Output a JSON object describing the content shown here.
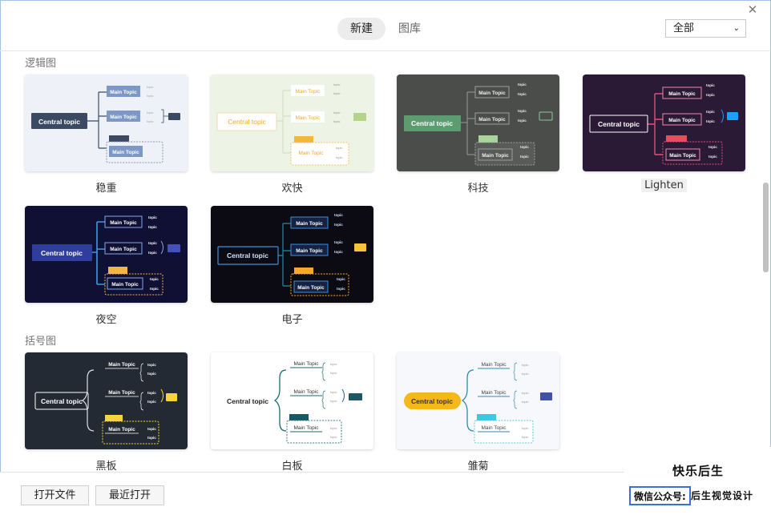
{
  "header": {
    "tabs": [
      {
        "label": "新建",
        "active": true
      },
      {
        "label": "图库",
        "active": false
      }
    ],
    "filter": {
      "value": "全部"
    },
    "close_icon": "close-icon"
  },
  "sections": [
    {
      "title": "逻辑图",
      "templates": [
        {
          "label": "稳重",
          "bg": "#eef2f8",
          "central": "Central topic",
          "main": "Main Topic",
          "sub": "topic"
        },
        {
          "label": "欢快",
          "bg": "#edf4e6",
          "central": "Central topic",
          "main": "Main Topic",
          "sub": "topic"
        },
        {
          "label": "科技",
          "bg": "#4b4d4a",
          "central": "Central topic",
          "main": "Main Topic",
          "sub": "topic"
        },
        {
          "label": "Lighten",
          "bg": "#2a1a36",
          "central": "Central topic",
          "main": "Main Topic",
          "sub": "topic"
        },
        {
          "label": "夜空",
          "bg": "#0f1033",
          "central": "Central topic",
          "main": "Main Topic",
          "sub": "topic"
        },
        {
          "label": "电子",
          "bg": "#0c0b14",
          "central": "Central topic",
          "main": "Main Topic",
          "sub": "topic"
        }
      ]
    },
    {
      "title": "括号图",
      "templates": [
        {
          "label": "黑板",
          "bg": "#232a33",
          "central": "Central topic",
          "main": "Main Topic",
          "sub": "topic"
        },
        {
          "label": "白板",
          "bg": "#ffffff",
          "central": "Central topic",
          "main": "Main Topic",
          "sub": "topic"
        },
        {
          "label": "雏菊",
          "bg": "#f7f8fb",
          "central": "Central topic",
          "main": "Main Topic",
          "sub": "topic"
        }
      ]
    }
  ],
  "footer": {
    "open_file": "打开文件",
    "recent": "最近打开"
  },
  "watermark": {
    "title": "快乐后生",
    "tag": "微信公众号:",
    "text": "后生视觉设计"
  },
  "colors": {
    "accent": "#3a6fd8",
    "steady_central": "#3a4a63",
    "steady_main": "#7d98c6",
    "happy_central": "#f1a53a",
    "tech_central": "#5d9c70",
    "lighten_accent": "#e14f7b",
    "night_central": "#2f3d9c",
    "electronic_accent": "#3d8fd8",
    "daisy_central": "#f4b81c"
  }
}
